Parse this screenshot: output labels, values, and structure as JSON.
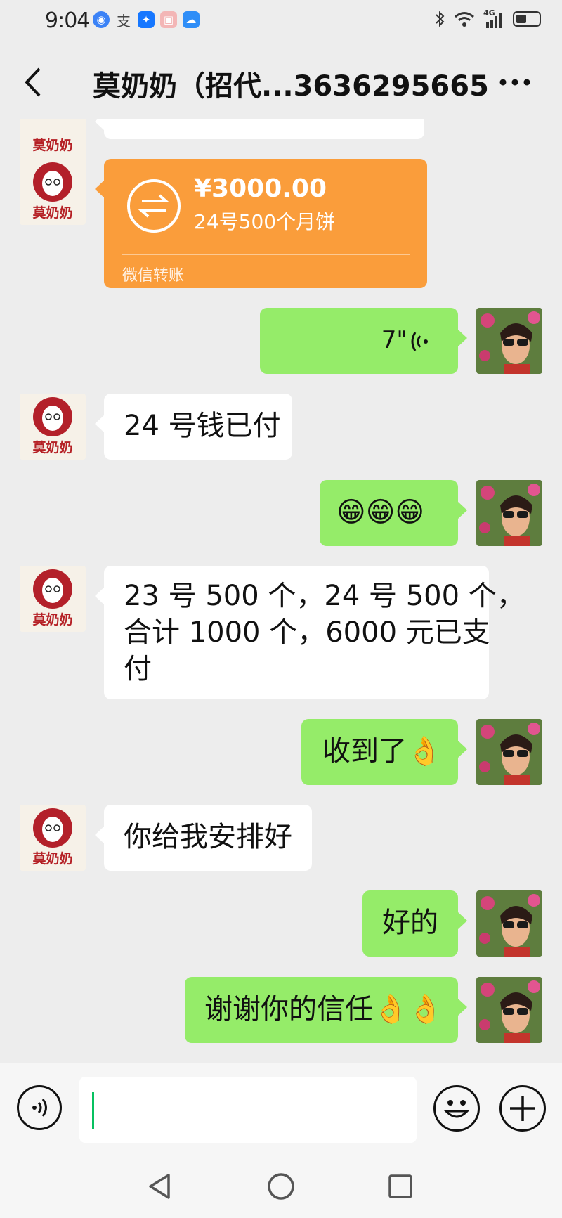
{
  "status_bar": {
    "time": "9:04",
    "network_label": "4G"
  },
  "header": {
    "title": "莫奶奶（招代...3636295665"
  },
  "chat": {
    "transfer": {
      "amount": "¥3000.00",
      "note": "24号500个月饼",
      "label": "微信转账"
    },
    "voice": {
      "duration": "7\""
    },
    "messages": [
      {
        "from": "other",
        "text": "24 号钱已付"
      },
      {
        "from": "me",
        "text": "😁😁😁"
      },
      {
        "from": "other",
        "lines": [
          "23 号 500 个，24 号 500 个，",
          "合计 1000 个，6000 元已支",
          "付"
        ]
      },
      {
        "from": "me",
        "text": "收到了👌"
      },
      {
        "from": "other",
        "text": "你给我安排好"
      },
      {
        "from": "me",
        "text": "好的"
      },
      {
        "from": "me",
        "text": "谢谢你的信任👌👌"
      }
    ],
    "avatar_text": "莫奶奶"
  },
  "colors": {
    "background": "#ededed",
    "outgoing_bubble": "#95ec69",
    "incoming_bubble": "#ffffff",
    "transfer_card": "#fa9d3b",
    "cursor": "#07c160"
  },
  "icons": {
    "back": "chevron-left-icon",
    "more": "more-dots-icon",
    "voice": "voice-icon",
    "emoji": "smiley-icon",
    "plus": "plus-icon"
  }
}
